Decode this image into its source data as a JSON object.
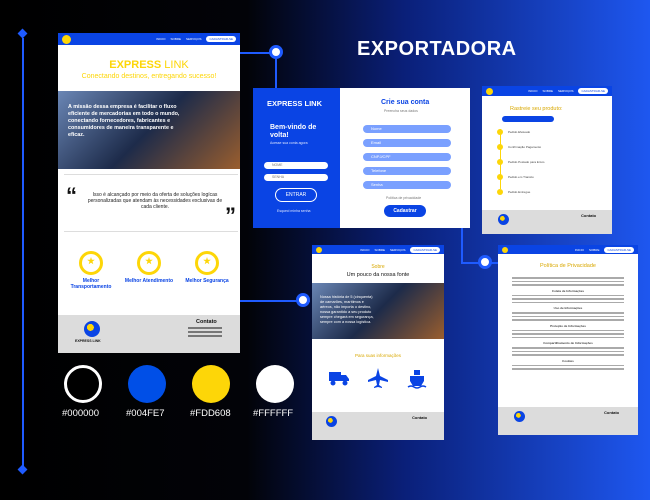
{
  "heading": "EXPORTADORA",
  "nav": {
    "items": [
      "INICIO",
      "SOBRE",
      "SERVIÇOS"
    ],
    "cta": "CADASTRAR-SE"
  },
  "main": {
    "brand_bold": "EXPRESS",
    "brand_light": " LINK",
    "tagline": "Conectando destinos, entregando sucesso!",
    "hero_text": "A missão dessa empresa é facilitar o fluxo eficiente de mercadorias em todo o mundo, conectando fornecedores, fabricantes e consumidores de maneira transparente e eficaz.",
    "quote_text": "Isso é alcançado por meio da oferta de soluções logícas personalizadas que atendam às necessidades exclusivas de cada cliente.",
    "awards": [
      {
        "label": "Melhor Transportamento"
      },
      {
        "label": "Melhor Atendimento"
      },
      {
        "label": "Melhor Segurança"
      }
    ],
    "footer_brand": "EXPRESS LINK",
    "contact_title": "Contato"
  },
  "login": {
    "brand": "EXPRESS LINK",
    "welcome": "Bem-vindo de volta!",
    "subtitle": "Acesse sua conta agora",
    "field_user": "NOME",
    "field_pass": "SENHA",
    "enter": "ENTRAR",
    "forgot": "Esqueci minha senha",
    "create_title": "Crie sua conta",
    "create_sub": "Preencha seus dados",
    "fields": [
      "Nome",
      "Email",
      "CNPJ/CPF",
      "Telefone",
      "Senha"
    ],
    "terms": "Política de privacidade",
    "register": "Cadastrar"
  },
  "tracking": {
    "title": "Rastreie seu produto:",
    "steps": [
      "Pedido Efetuado",
      "Confirmação Pagamento",
      "Pedido Postado para Envio",
      "Pedido em Transito",
      "Pedido Entregue"
    ]
  },
  "about": {
    "title": "Sobre",
    "subtitle": "Um pouco da nossa fonte",
    "text": "Nossa história de 5 (cinquenta) de camarões, marítimos e aéreos, não importa o destino, nossa garantido a seu produto sempre chegará em segurança, sempre com a nossa logística.",
    "services_title": "Para suas informações"
  },
  "privacy": {
    "title": "Política de Privacidade",
    "sections": [
      "Coleta de Informações",
      "Uso de Informações",
      "Proteção de Informações",
      "Compartilhamento de Informações",
      "Cookies"
    ]
  },
  "palette": [
    {
      "hex": "#000000",
      "color": "#000000"
    },
    {
      "hex": "#004FE7",
      "color": "#004FE7"
    },
    {
      "hex": "#FDD608",
      "color": "#FDD608"
    },
    {
      "hex": "#FFFFFF",
      "color": "#FFFFFF"
    }
  ]
}
